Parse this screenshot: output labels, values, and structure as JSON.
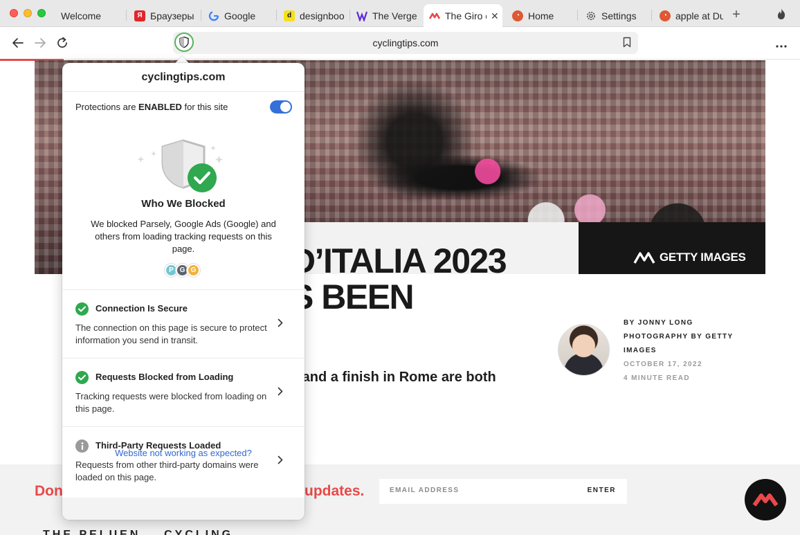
{
  "browser": {
    "tabs": [
      {
        "title": "Welcome",
        "favicon": "",
        "active": false
      },
      {
        "title": "Браузеры",
        "favicon": "yandex-icon",
        "active": false
      },
      {
        "title": "Google",
        "favicon": "google-icon",
        "active": false
      },
      {
        "title": "designboo",
        "favicon": "designboom-icon",
        "active": false
      },
      {
        "title": "The Verge",
        "favicon": "verge-icon",
        "active": false
      },
      {
        "title": "The Giro d",
        "favicon": "cyclingtips-icon",
        "active": true
      },
      {
        "title": "Home",
        "favicon": "duckduckgo-icon",
        "active": false
      },
      {
        "title": "Settings",
        "favicon": "gear-icon",
        "active": false
      },
      {
        "title": "apple at Du",
        "favicon": "duckduckgo-icon",
        "active": false
      }
    ],
    "url": "cyclingtips.com",
    "colors": {
      "accent": "#e8494a",
      "toggle": "#3470d8",
      "secure": "#2fa84f",
      "link": "#3167d1"
    }
  },
  "page": {
    "headline_line1": "D’ITALIA 2023",
    "headline_line2": "S BEEN",
    "subhead": "e and a finish in Rome are both",
    "image_credit": "GETTY IMAGES",
    "byline": {
      "author": "BY JONNY LONG",
      "photo": "PHOTOGRAPHY BY GETTY",
      "photo2": "IMAGES",
      "date": "OCTOBER 17, 2022",
      "read_time": "4 MINUTE READ"
    },
    "signup": {
      "left_text": "Don",
      "right_text": "updates.",
      "email_placeholder": "EMAIL ADDRESS",
      "enter_label": "ENTER"
    },
    "bottom_peek": "THE PELUEN... CYCLING"
  },
  "popover": {
    "domain": "cyclingtips.com",
    "protections_prefix": "Protections are ",
    "protections_state": "ENABLED",
    "protections_suffix": " for this site",
    "toggle_on": true,
    "who_title": "Who We Blocked",
    "who_desc": "We blocked Parsely, Google Ads (Google) and others from loading tracking requests on this page.",
    "trackers": [
      {
        "letter": "P",
        "color": "#76c6cf"
      },
      {
        "letter": "G",
        "color": "#5a6470"
      },
      {
        "letter": "G",
        "color": "#f0b33c"
      }
    ],
    "sections": [
      {
        "title": "Connection Is Secure",
        "desc": "The connection on this page is secure to protect information you send in transit.",
        "status": "check"
      },
      {
        "title": "Requests Blocked from Loading",
        "desc": "Tracking requests were blocked from loading on this page.",
        "status": "check"
      },
      {
        "title": "Third-Party Requests Loaded",
        "desc": "Requests from other third-party domains were loaded on this page.",
        "status": "info"
      }
    ],
    "footer_link": "Website not working as expected?"
  }
}
